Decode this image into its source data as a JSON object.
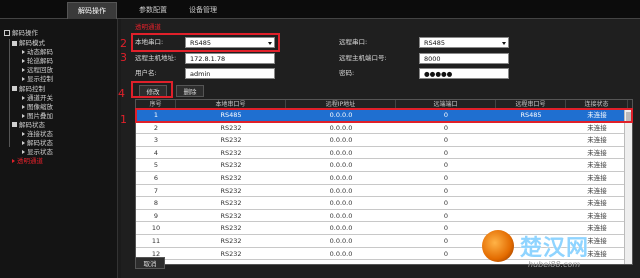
{
  "tabs": [
    "解码操作",
    "参数配置",
    "设备管理"
  ],
  "sidebar": {
    "root": "解码操作",
    "items": [
      {
        "label": "解码模式",
        "level": 1
      },
      {
        "label": "动态解码",
        "level": 2
      },
      {
        "label": "轮巡解码",
        "level": 2
      },
      {
        "label": "远程回放",
        "level": 2
      },
      {
        "label": "显示控制",
        "level": 2
      },
      {
        "label": "解码控制",
        "level": 1
      },
      {
        "label": "通道开关",
        "level": 2
      },
      {
        "label": "图像缩放",
        "level": 2
      },
      {
        "label": "图片叠加",
        "level": 2
      },
      {
        "label": "解码状态",
        "level": 1
      },
      {
        "label": "连接状态",
        "level": 2
      },
      {
        "label": "解码状态",
        "level": 2
      },
      {
        "label": "显示状态",
        "level": 2
      },
      {
        "label": "透明通道",
        "level": 1,
        "active": true
      }
    ]
  },
  "form": {
    "section_title": "透明通道",
    "local_port_label": "本地串口:",
    "local_port_value": "RS485",
    "remote_port_label": "远程串口:",
    "remote_port_value": "RS485",
    "remote_host_label": "远程主机地址:",
    "remote_host_value": "172.8.1.78",
    "remote_host_port_label": "远程主机端口号:",
    "remote_host_port_value": "8000",
    "username_label": "用户名:",
    "username_value": "admin",
    "password_label": "密码:",
    "password_value": "●●●●●"
  },
  "buttons": {
    "modify": "修改",
    "delete": "删除",
    "cancel": "取消"
  },
  "callouts": [
    "2",
    "3",
    "4",
    "1"
  ],
  "table": {
    "headers": [
      "序号",
      "本地串口号",
      "远程IP地址",
      "远端端口",
      "远程串口号",
      "连接状态"
    ],
    "rows": [
      [
        "1",
        "RS485",
        "0.0.0.0",
        "0",
        "RS485",
        "未连接"
      ],
      [
        "2",
        "RS232",
        "0.0.0.0",
        "0",
        "",
        "未连接"
      ],
      [
        "3",
        "RS232",
        "0.0.0.0",
        "0",
        "",
        "未连接"
      ],
      [
        "4",
        "RS232",
        "0.0.0.0",
        "0",
        "",
        "未连接"
      ],
      [
        "5",
        "RS232",
        "0.0.0.0",
        "0",
        "",
        "未连接"
      ],
      [
        "6",
        "RS232",
        "0.0.0.0",
        "0",
        "",
        "未连接"
      ],
      [
        "7",
        "RS232",
        "0.0.0.0",
        "0",
        "",
        "未连接"
      ],
      [
        "8",
        "RS232",
        "0.0.0.0",
        "0",
        "",
        "未连接"
      ],
      [
        "9",
        "RS232",
        "0.0.0.0",
        "0",
        "",
        "未连接"
      ],
      [
        "10",
        "RS232",
        "0.0.0.0",
        "0",
        "",
        "未连接"
      ],
      [
        "11",
        "RS232",
        "0.0.0.0",
        "0",
        "",
        "未连接"
      ],
      [
        "12",
        "RS232",
        "0.0.0.0",
        "0",
        "",
        "未连接"
      ]
    ]
  },
  "watermark": {
    "title": "楚汉网",
    "url": "hubei88.com"
  },
  "colors": {
    "accent": "#e0202a",
    "selected_row": "#1f6fd0"
  }
}
